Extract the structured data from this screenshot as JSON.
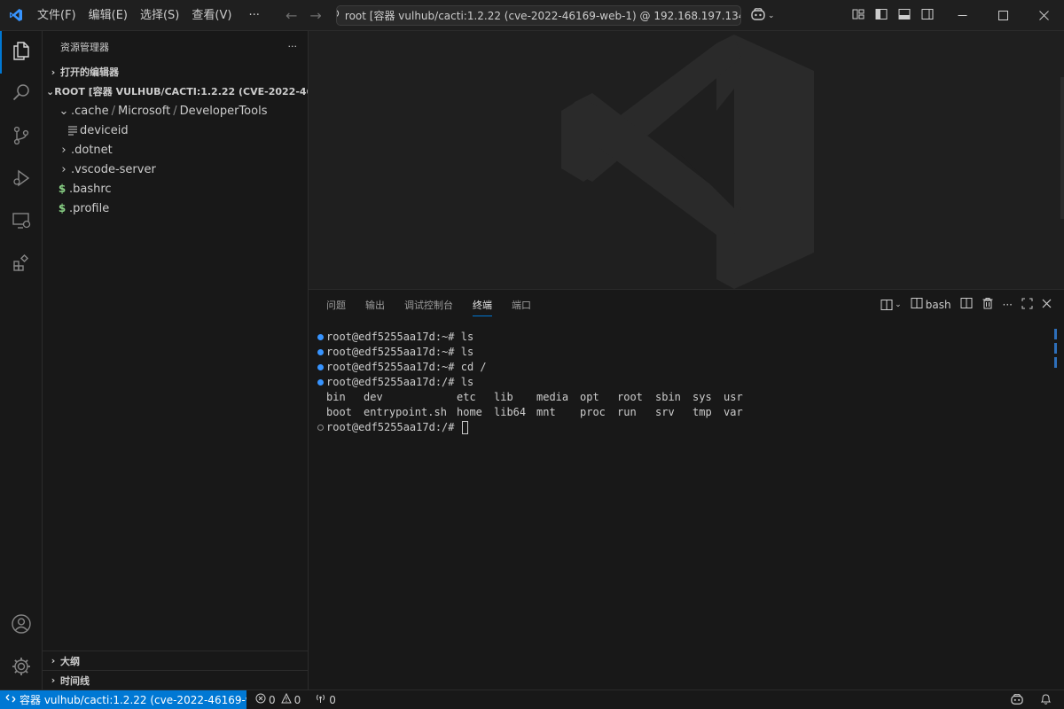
{
  "menu": [
    "文件(F)",
    "编辑(E)",
    "选择(S)",
    "查看(V)",
    "···"
  ],
  "command_center": "root [容器 vulhub/cacti:1.2.22 (cve-2022-46169-web-1) @ 192.168.197.134]",
  "explorer": {
    "title": "资源管理器",
    "more": "···",
    "open_editors": "打开的编辑器",
    "root": "ROOT [容器 VULHUB/CACTI:1.2.22 (CVE-2022-4616...",
    "tree": {
      "cache": ".cache",
      "microsoft": "Microsoft",
      "devtools": "DeveloperTools",
      "deviceid": "deviceid",
      "dotnet": ".dotnet",
      "vscode_server": ".vscode-server",
      "bashrc": ".bashrc",
      "profile": ".profile"
    },
    "outline": "大纲",
    "timeline": "时间线"
  },
  "panel": {
    "tabs": [
      "问题",
      "输出",
      "调试控制台",
      "终端",
      "端口"
    ],
    "active_tab": "终端",
    "shell": "bash"
  },
  "terminal": {
    "lines": [
      "root@edf5255aa17d:~# ls",
      "root@edf5255aa17d:~# ls",
      "root@edf5255aa17d:~# cd /",
      "root@edf5255aa17d:/# ls"
    ],
    "ls_row1": [
      "bin",
      "dev",
      "etc",
      "lib",
      "media",
      "opt",
      "root",
      "sbin",
      "sys",
      "usr"
    ],
    "ls_row2": [
      "boot",
      "entrypoint.sh",
      "home",
      "lib64",
      "mnt",
      "proc",
      "run",
      "srv",
      "tmp",
      "var"
    ],
    "prompt": "root@edf5255aa17d:/# "
  },
  "status": {
    "remote": "容器 vulhub/cacti:1.2.22 (cve-2022-46169-w...",
    "errors": "0",
    "warnings": "0",
    "ports": "0"
  },
  "colors": {
    "accent": "#0078d4",
    "shell_ok": "#89d185"
  }
}
